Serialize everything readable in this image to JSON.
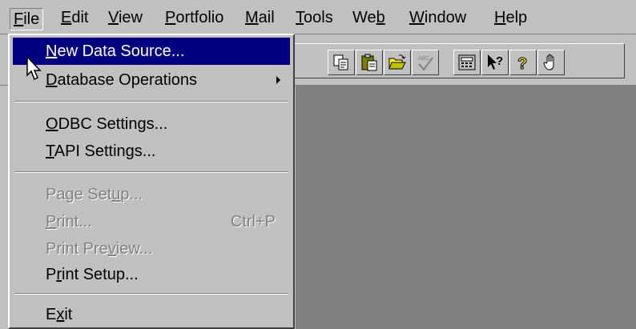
{
  "menubar": {
    "items": [
      {
        "pre": "",
        "acc": "F",
        "post": "ile"
      },
      {
        "pre": "",
        "acc": "E",
        "post": "dit"
      },
      {
        "pre": "",
        "acc": "V",
        "post": "iew"
      },
      {
        "pre": "",
        "acc": "P",
        "post": "ortfolio"
      },
      {
        "pre": "",
        "acc": "M",
        "post": "ail"
      },
      {
        "pre": "",
        "acc": "T",
        "post": "ools"
      },
      {
        "pre": "We",
        "acc": "b",
        "post": ""
      },
      {
        "pre": "",
        "acc": "W",
        "post": "indow"
      },
      {
        "pre": "",
        "acc": "H",
        "post": "elp"
      }
    ]
  },
  "file_menu": {
    "items": [
      {
        "pre": "",
        "acc": "N",
        "post": "ew Data Source...",
        "state": "highlighted"
      },
      {
        "pre": "",
        "acc": "D",
        "post": "atabase Operations",
        "state": "normal",
        "submenu": true
      },
      {
        "pre": "",
        "acc": "O",
        "post": "DBC Settings...",
        "state": "normal"
      },
      {
        "pre": "",
        "acc": "T",
        "post": "API Settings...",
        "state": "normal"
      },
      {
        "pre": "Page Set",
        "acc": "u",
        "post": "p...",
        "state": "disabled"
      },
      {
        "pre": "",
        "acc": "P",
        "post": "rint...",
        "state": "disabled",
        "shortcut": "Ctrl+P"
      },
      {
        "pre": "Print Pre",
        "acc": "v",
        "post": "iew...",
        "state": "disabled"
      },
      {
        "pre": "P",
        "acc": "r",
        "post": "int Setup...",
        "state": "normal"
      },
      {
        "pre": "E",
        "acc": "x",
        "post": "it",
        "state": "normal"
      }
    ]
  },
  "toolbar": {
    "buttons": [
      "copy-icon",
      "paste-icon",
      "open-folder-icon",
      "spell-check-icon",
      "calculator-icon",
      "context-help-icon",
      "help-icon",
      "hand-icon"
    ],
    "spell_glyph": "ABC",
    "context_help_glyph": "?",
    "help_glyph": "?"
  },
  "colors": {
    "face": "#c0c0c0",
    "highlight": "#000080",
    "workspace": "#808080",
    "help_yellow": "#ffff00"
  }
}
